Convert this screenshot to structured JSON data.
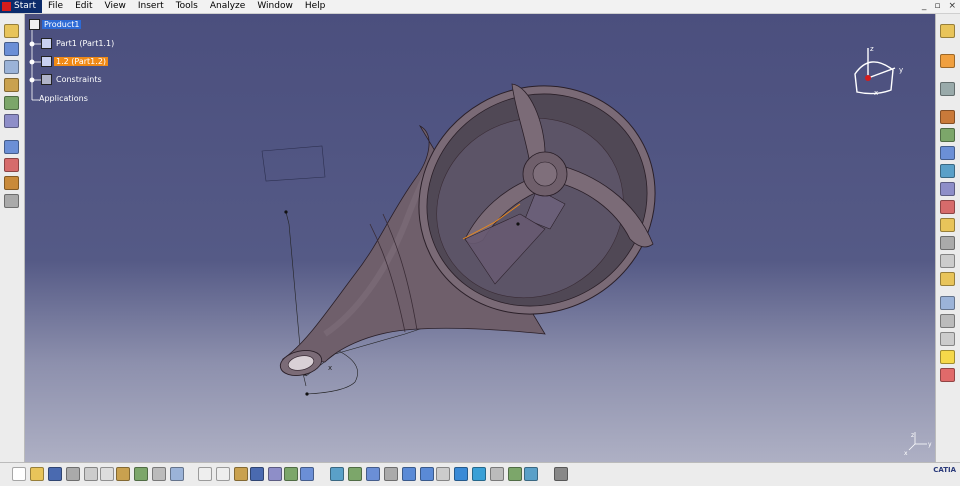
{
  "menubar": {
    "items": [
      "Start",
      "File",
      "Edit",
      "View",
      "Insert",
      "Tools",
      "Analyze",
      "Window",
      "Help"
    ]
  },
  "window_controls": [
    "_",
    "▫",
    "×"
  ],
  "tree": {
    "root": "Product1",
    "children": [
      {
        "label": "Part1 (Part1.1)",
        "state": "normal"
      },
      {
        "label": "1.2 (Part1.2)",
        "state": "selected"
      },
      {
        "label": "Constraints",
        "state": "normal"
      },
      {
        "label": "Applications",
        "state": "normal"
      }
    ]
  },
  "compass": {
    "x_label": "x",
    "y_label": "y",
    "z_label": "z"
  },
  "mini_axis": {
    "x_label": "x",
    "y_label": "y",
    "z_label": "z"
  },
  "viewport_label": "x",
  "brand": "CATIA",
  "colors": {
    "menubar_start": "#0b2b6b",
    "tree_selected_root": "#2d6bd6",
    "tree_selected_part": "#f08a16",
    "viewport_top": "#4b4f7e",
    "viewport_bottom": "#aeb0c4",
    "model": "#6f5f6b"
  }
}
